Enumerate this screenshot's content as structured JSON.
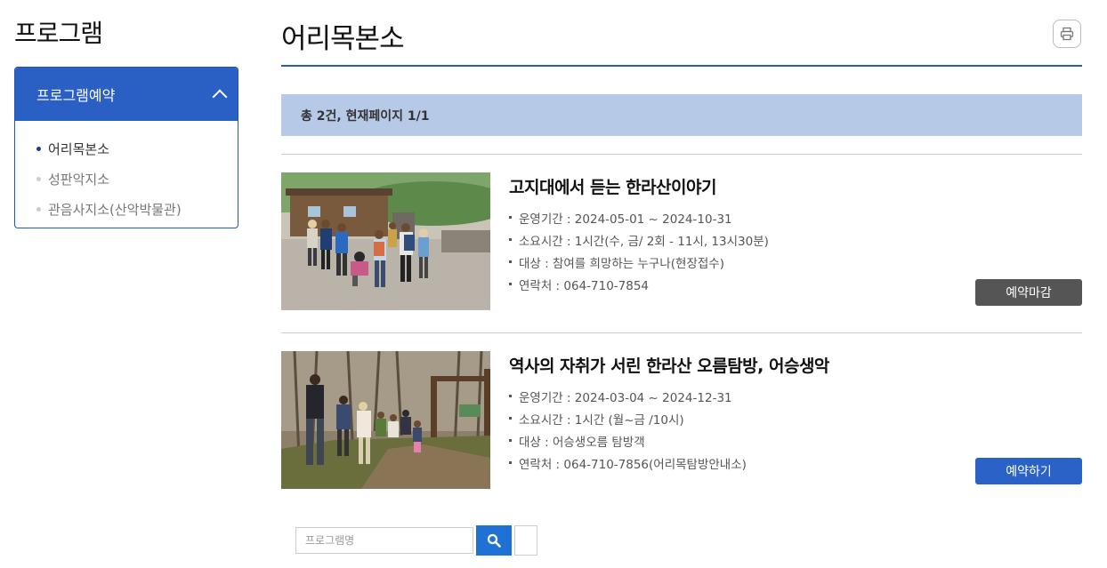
{
  "sidebar": {
    "title": "프로그램",
    "section_label": "프로그램예약",
    "items": [
      {
        "label": "어리목본소",
        "active": true
      },
      {
        "label": "성판악지소",
        "active": false
      },
      {
        "label": "관음사지소(산악박물관)",
        "active": false
      }
    ]
  },
  "main": {
    "title": "어리목본소",
    "print_icon": "printer-icon",
    "summary": "총 2건, 현재페이지 1/1",
    "programs": [
      {
        "title": "고지대에서 듣는 한라산이야기",
        "period": "운영기간 : 2024-05-01 ~ 2024-10-31",
        "duration": "소요시간 : 1시간(수, 금/ 2회 - 11시, 13시30분)",
        "target": "대상 : 참여를 희망하는 누구나(현장접수)",
        "contact": "연락처 : 064-710-7854",
        "button": "예약마감",
        "status": "closed"
      },
      {
        "title": "역사의 자취가 서린 한라산 오름탐방, 어승생악",
        "period": "운영기간 : 2024-03-04 ~ 2024-12-31",
        "duration": "소요시간 : 1시간 (월~금 /10시)",
        "target": "대상 : 어승생오름 탐방객",
        "contact": "연락처 : 064-710-7856(어리목탐방안내소)",
        "button": "예약하기",
        "status": "open"
      }
    ]
  },
  "search": {
    "placeholder": "프로그램명",
    "value": "",
    "search_icon": "search-icon"
  },
  "colors": {
    "primary": "#2a5fc4",
    "summary_bg": "#b6c9e7",
    "closed_button": "#555555",
    "open_button": "#2a62c8",
    "search_button": "#1f72d4"
  }
}
